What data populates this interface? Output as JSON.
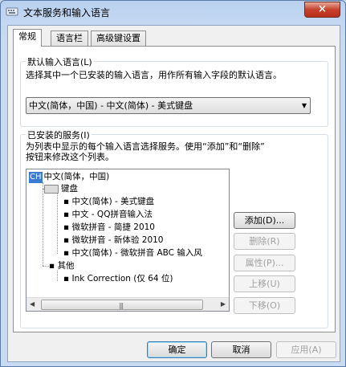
{
  "window": {
    "title": "文本服务和输入语言",
    "close_label": "×"
  },
  "tabs": [
    {
      "label": "常规",
      "active": true
    },
    {
      "label": "语言栏",
      "active": false
    },
    {
      "label": "高级键设置",
      "active": false
    }
  ],
  "default_language": {
    "title": "默认输入语言(L)",
    "description": "选择其中一个已安装的输入语言，用作所有输入字段的默认语言。",
    "selected": "中文(简体，中国) - 中文(简体) - 美式键盘"
  },
  "installed_services": {
    "title": "已安装的服务(I)",
    "description_line1": "为列表中显示的每个输入语言选择服务。使用“添加”和“删除”",
    "description_line2": "按钮来修改这个列表。",
    "tree": {
      "language_badge": "CH",
      "language": "中文(简体，中国)",
      "keyboard_group": "键盘",
      "keyboards": [
        "中文(简体) - 美式键盘",
        "中文 - QQ拼音输入法",
        "微软拼音 - 简捷 2010",
        "微软拼音 - 新体验 2010",
        "中文(简体) - 微软拼音 ABC 输入风"
      ],
      "other_group": "其他",
      "other_items": [
        "Ink Correction (仅 64 位)"
      ]
    },
    "buttons": {
      "add": "添加(D)...",
      "remove": "删除(R)",
      "properties": "属性(P)...",
      "move_up": "上移(U)",
      "move_down": "下移(O)"
    }
  },
  "footer": {
    "ok": "确定",
    "cancel": "取消",
    "apply": "应用(A)"
  }
}
